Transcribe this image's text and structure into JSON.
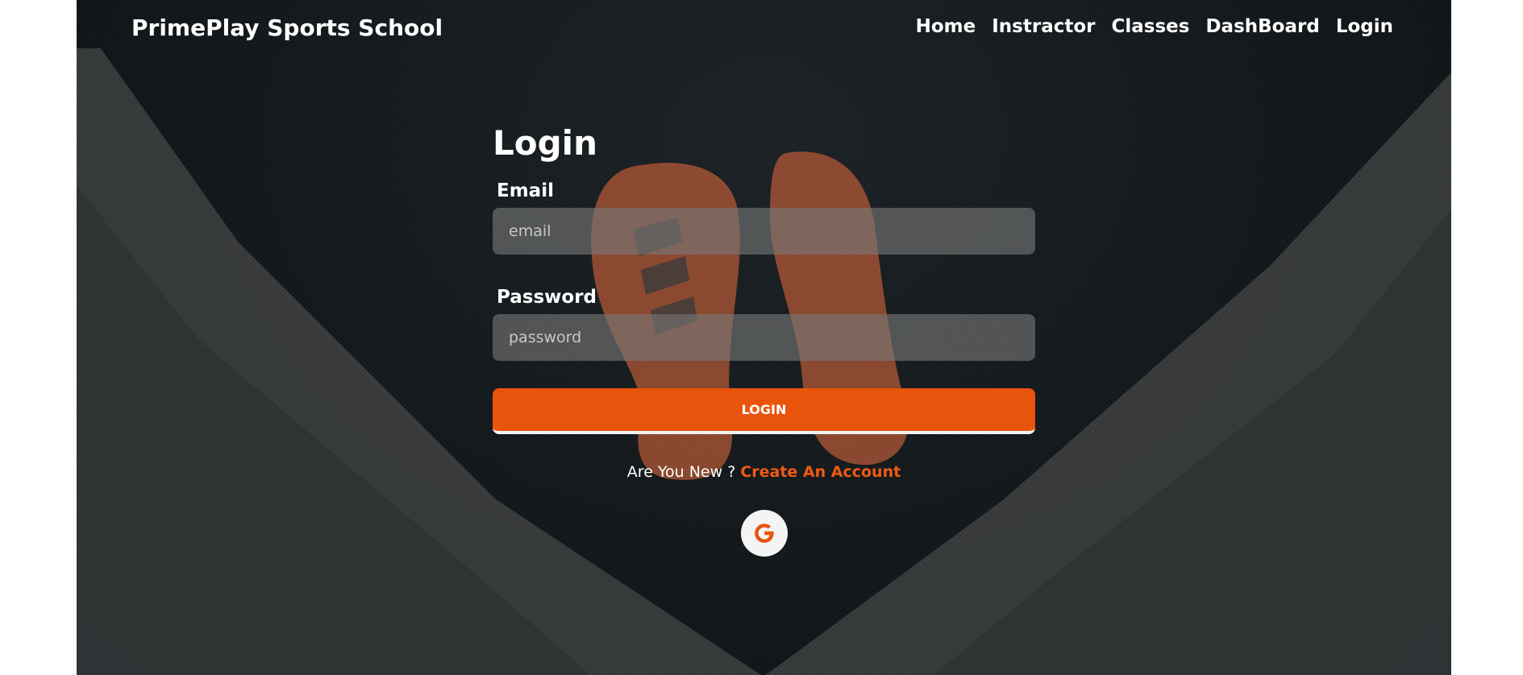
{
  "nav": {
    "brand": "PrimePlay Sports School",
    "links": [
      "Home",
      "Instractor",
      "Classes",
      "DashBoard",
      "Login"
    ]
  },
  "login": {
    "title": "Login",
    "email_label": "Email",
    "email_placeholder": "email",
    "password_label": "Password",
    "password_placeholder": "password",
    "submit_label": "LOGIN",
    "new_prompt": "Are You New ?",
    "create_account_label": "Create An Account",
    "google_icon": "google-icon"
  },
  "colors": {
    "accent": "#e8540c",
    "link": "#f05a12",
    "background": "#14191c"
  }
}
